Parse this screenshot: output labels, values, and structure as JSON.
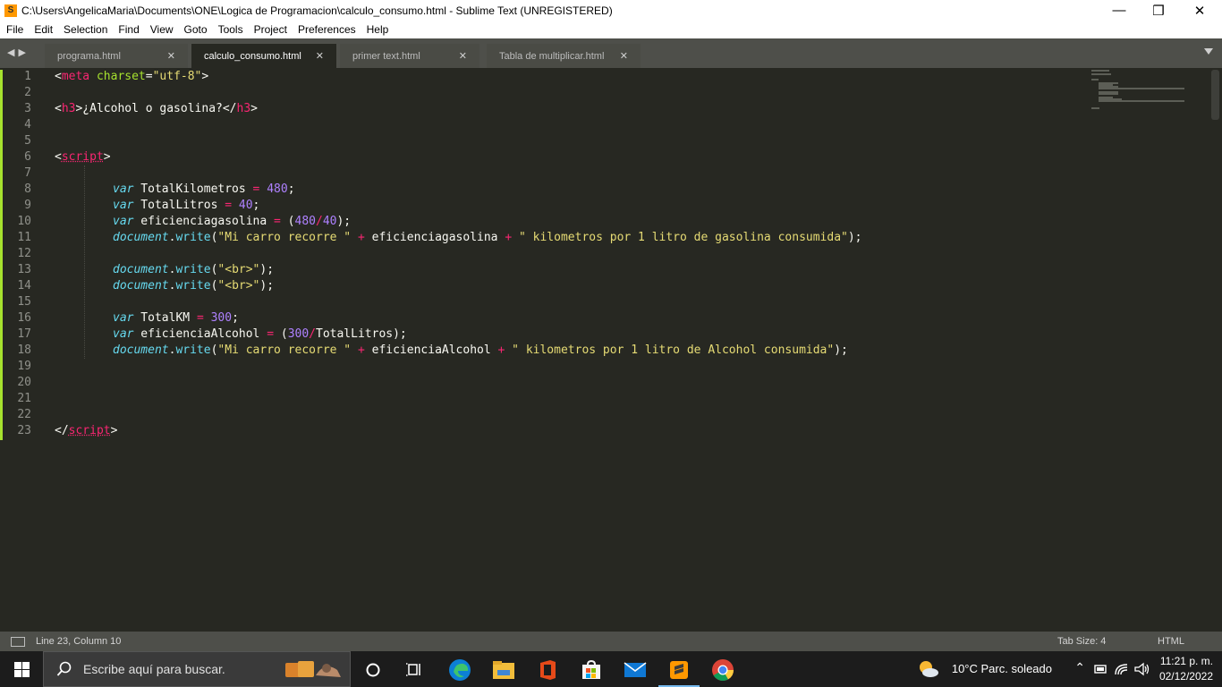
{
  "window": {
    "title": "C:\\Users\\AngelicaMaria\\Documents\\ONE\\Logica de Programacion\\calculo_consumo.html - Sublime Text (UNREGISTERED)",
    "minimize": "—",
    "maximize": "❒",
    "close": "✕"
  },
  "menu": [
    "File",
    "Edit",
    "Selection",
    "Find",
    "View",
    "Goto",
    "Tools",
    "Project",
    "Preferences",
    "Help"
  ],
  "tabs": [
    {
      "label": "programa.html",
      "active": false
    },
    {
      "label": "calculo_consumo.html",
      "active": true
    },
    {
      "label": "primer text.html",
      "active": false
    },
    {
      "label": "Tabla de multiplicar.html",
      "active": false
    }
  ],
  "editor": {
    "line_numbers": [
      "1",
      "2",
      "3",
      "4",
      "5",
      "6",
      "7",
      "8",
      "9",
      "10",
      "11",
      "12",
      "13",
      "14",
      "15",
      "16",
      "17",
      "18",
      "19",
      "20",
      "21",
      "22",
      "23"
    ],
    "code": {
      "l1": [
        "<",
        "meta",
        " ",
        "charset",
        "=",
        "\"utf-8\"",
        ">"
      ],
      "l3": [
        "<",
        "h3",
        ">¿Alcohol o gasolina?</",
        "h3",
        ">"
      ],
      "l6": [
        "<",
        "script",
        ">"
      ],
      "l8": [
        "var",
        " TotalKilometros ",
        "=",
        " ",
        "480",
        ";"
      ],
      "l9": [
        "var",
        " TotalLitros ",
        "=",
        " ",
        "40",
        ";"
      ],
      "l10": [
        "var",
        " eficienciagasolina ",
        "=",
        " (",
        "480",
        "/",
        "40",
        ");"
      ],
      "l11": [
        "document",
        ".",
        "write",
        "(",
        "\"Mi carro recorre \"",
        " ",
        "+",
        " eficienciagasolina ",
        "+",
        " ",
        "\" kilometros por 1 litro de gasolina consumida\"",
        ");"
      ],
      "l13": [
        "document",
        ".",
        "write",
        "(",
        "\"<br>\"",
        ");"
      ],
      "l14": [
        "document",
        ".",
        "write",
        "(",
        "\"<br>\"",
        ");"
      ],
      "l16": [
        "var",
        " TotalKM ",
        "=",
        " ",
        "300",
        ";"
      ],
      "l17": [
        "var",
        " eficienciaAlcohol ",
        "=",
        " (",
        "300",
        "/",
        "TotalLitros);"
      ],
      "l18": [
        "document",
        ".",
        "write",
        "(",
        "\"Mi carro recorre \"",
        " ",
        "+",
        " eficienciaAlcohol ",
        "+",
        " ",
        "\" kilometros por 1 litro de Alcohol consumida\"",
        ");"
      ],
      "l23": [
        "</",
        "script",
        ">"
      ]
    }
  },
  "status": {
    "position": "Line 23, Column 10",
    "tab_size": "Tab Size: 4",
    "syntax": "HTML"
  },
  "taskbar": {
    "search_placeholder": "Escribe aquí para buscar.",
    "weather": "10°C  Parc. soleado",
    "time": "11:21 p. m.",
    "date": "02/12/2022"
  }
}
